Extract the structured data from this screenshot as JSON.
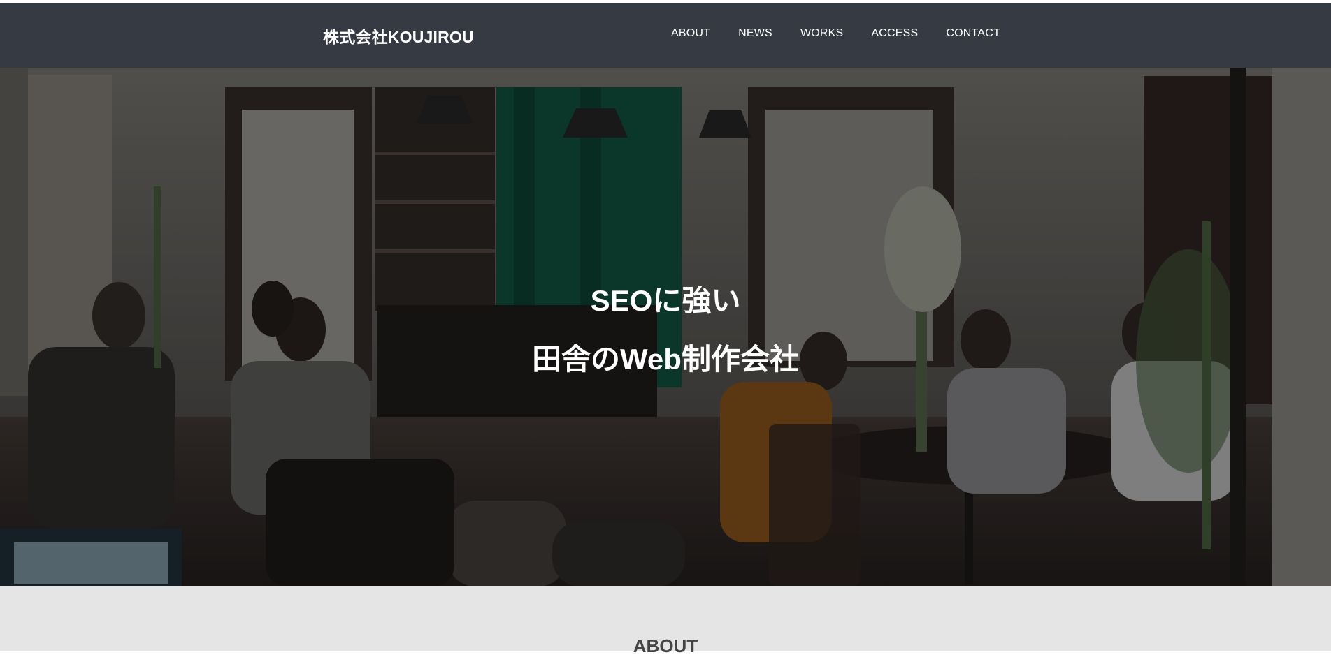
{
  "header": {
    "logo": "株式会社KOUJIROU",
    "nav": [
      "ABOUT",
      "NEWS",
      "WORKS",
      "ACCESS",
      "CONTACT"
    ]
  },
  "hero": {
    "line1": "SEOに強い",
    "line2": "田舎のWeb制作会社",
    "image_description_icon": "cafe-photo"
  },
  "about": {
    "title": "ABOUT"
  },
  "colors": {
    "header_bg": "#363b43",
    "about_bg": "#e4e5e4",
    "text_light": "#ffffff",
    "text_dark": "#444444"
  }
}
